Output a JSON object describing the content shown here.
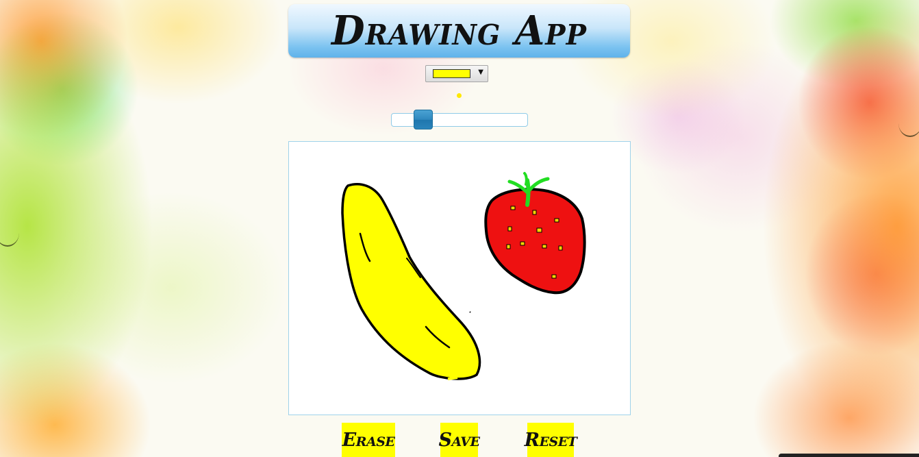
{
  "app": {
    "title": "Drawing App"
  },
  "color_picker": {
    "selected_color": "#ffff00"
  },
  "brush": {
    "preview_color": "#ffe800",
    "size_fraction": 0.19
  },
  "canvas": {
    "background": "#ffffff",
    "drawing_colors": [
      "#ffff00",
      "#ee1111",
      "#22dd22",
      "#000000"
    ]
  },
  "buttons": {
    "erase_label": "Erase",
    "save_label": "Save",
    "reset_label": "Reset",
    "color": "#ffff00"
  },
  "accent": {
    "title_gradient_end": "#5fb2ea",
    "slider_thumb": "#2f88bf"
  }
}
